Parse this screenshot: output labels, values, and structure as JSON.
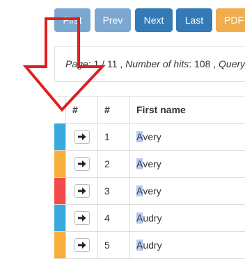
{
  "toolbar": {
    "first_label": "First",
    "prev_label": "Prev",
    "next_label": "Next",
    "last_label": "Last",
    "pdf_label": "PDF",
    "colors": {
      "disabled": "#7ba7d0",
      "primary": "#337ab7",
      "warning": "#f0ad4e"
    }
  },
  "info": {
    "page_label": "Page",
    "page_current": "1",
    "page_total": "11",
    "hits_label": "Number of hits",
    "hits_value": "108",
    "query_label": "Query"
  },
  "table": {
    "headers": {
      "action": "#",
      "number": "#",
      "first_name": "First name"
    },
    "rows": [
      {
        "stripe_color": "#3aa9de",
        "number": "1",
        "name_highlight": "A",
        "name_rest": "very"
      },
      {
        "stripe_color": "#f7b03b",
        "number": "2",
        "name_highlight": "A",
        "name_rest": "very"
      },
      {
        "stripe_color": "#f24b4b",
        "number": "3",
        "name_highlight": "A",
        "name_rest": "very"
      },
      {
        "stripe_color": "#3aa9de",
        "number": "4",
        "name_highlight": "A",
        "name_rest": "udry"
      },
      {
        "stripe_color": "#f7b03b",
        "number": "5",
        "name_highlight": "A",
        "name_rest": "udry"
      }
    ]
  },
  "annotation": {
    "arrow_color": "#e02020",
    "arrow_icon": "down-arrow-outline-icon"
  }
}
